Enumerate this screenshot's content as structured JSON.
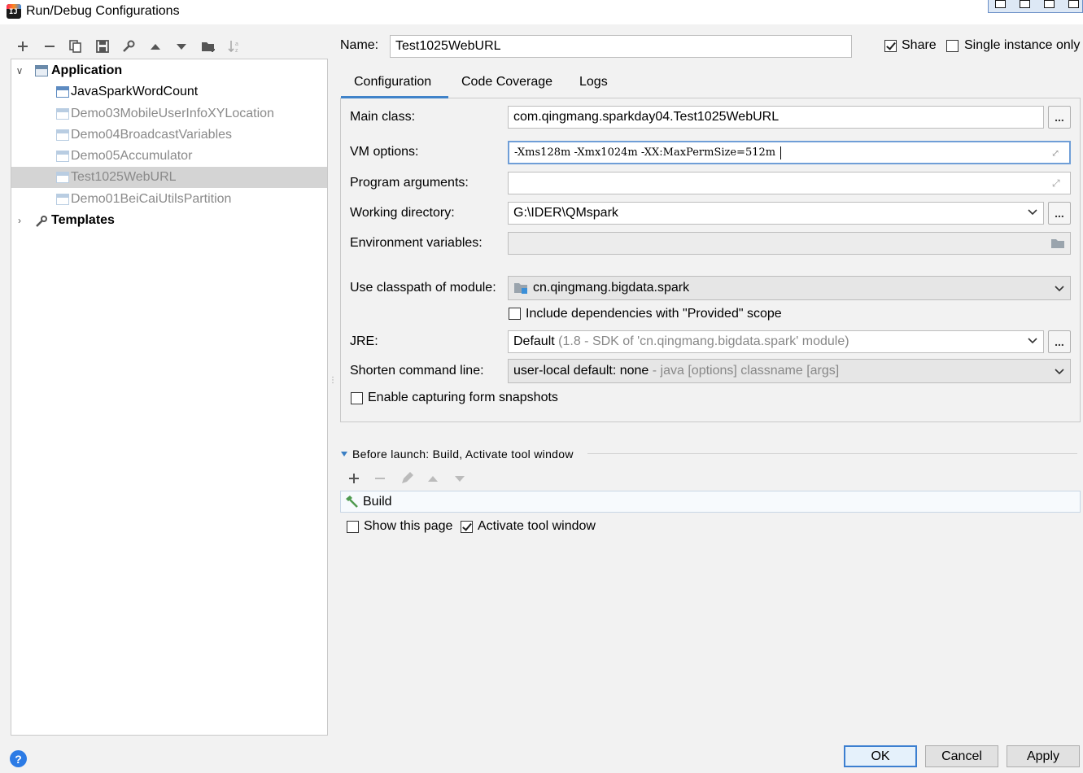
{
  "window": {
    "title": "Run/Debug Configurations",
    "app_icon": "intellij-icon"
  },
  "toolbar": {
    "buttons": [
      "add",
      "remove",
      "copy",
      "save",
      "edit-defaults",
      "move-up",
      "move-down",
      "new-folder",
      "sort"
    ]
  },
  "tree": {
    "application": {
      "label": "Application",
      "children": [
        {
          "label": "JavaSparkWordCount",
          "faded": false
        },
        {
          "label": "Demo03MobileUserInfoXYLocation",
          "faded": true
        },
        {
          "label": "Demo04BroadcastVariables",
          "faded": true
        },
        {
          "label": "Demo05Accumulator",
          "faded": true
        },
        {
          "label": "Test1025WebURL",
          "faded": true,
          "selected": true
        },
        {
          "label": "Demo01BeiCaiUtilsPartition",
          "faded": true
        }
      ]
    },
    "templates": {
      "label": "Templates"
    }
  },
  "header": {
    "name_label": "Name:",
    "name_value": "Test1025WebURL",
    "share_label": "Share",
    "share_checked": true,
    "single_instance_label": "Single instance only",
    "single_instance_checked": false
  },
  "tabs": [
    {
      "label": "Configuration",
      "active": true
    },
    {
      "label": "Code Coverage",
      "active": false
    },
    {
      "label": "Logs",
      "active": false
    }
  ],
  "config": {
    "main_class_label": "Main class:",
    "main_class_value": "com.qingmang.sparkday04.Test1025WebURL",
    "vm_options_label": "VM options:",
    "vm_options_value": "-Xms128m -Xmx1024m -XX:MaxPermSize=512m",
    "program_args_label": "Program arguments:",
    "program_args_value": "",
    "working_dir_label": "Working directory:",
    "working_dir_value": "G:\\IDER\\QMspark",
    "env_vars_label": "Environment variables:",
    "env_vars_value": "",
    "classpath_label": "Use classpath of module:",
    "classpath_value": "cn.qingmang.bigdata.spark",
    "include_deps_label": "Include dependencies with \"Provided\" scope",
    "include_deps_checked": false,
    "jre_label": "JRE:",
    "jre_value": "Default",
    "jre_detail": "(1.8 - SDK of 'cn.qingmang.bigdata.spark' module)",
    "shorten_label": "Shorten command line:",
    "shorten_value": "user-local default: none",
    "shorten_detail": "- java [options] classname [args]",
    "capture_label": "Enable capturing form snapshots",
    "capture_checked": false,
    "ellipsis": "..."
  },
  "before_launch": {
    "title": "Before launch: Build, Activate tool window",
    "items": [
      "Build"
    ],
    "show_page_label": "Show this page",
    "show_page_checked": false,
    "activate_label": "Activate tool window",
    "activate_checked": true
  },
  "footer": {
    "help_label": "?",
    "ok_label": "OK",
    "cancel_label": "Cancel",
    "apply_label": "Apply"
  },
  "colors": {
    "accent": "#4083c9",
    "selection": "#d4d4d4",
    "faded_text": "#8a8a8a"
  }
}
